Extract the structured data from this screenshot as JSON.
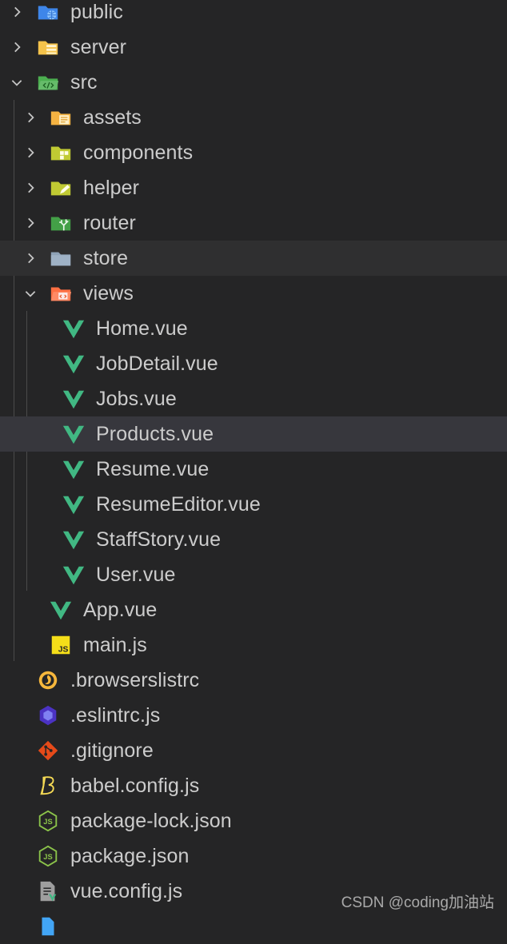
{
  "explorer": {
    "items": [
      {
        "label": "public"
      },
      {
        "label": "server"
      },
      {
        "label": "src"
      },
      {
        "label": "assets"
      },
      {
        "label": "components"
      },
      {
        "label": "helper"
      },
      {
        "label": "router"
      },
      {
        "label": "store"
      },
      {
        "label": "views"
      },
      {
        "label": "Home.vue"
      },
      {
        "label": "JobDetail.vue"
      },
      {
        "label": "Jobs.vue"
      },
      {
        "label": "Products.vue"
      },
      {
        "label": "Resume.vue"
      },
      {
        "label": "ResumeEditor.vue"
      },
      {
        "label": "StaffStory.vue"
      },
      {
        "label": "User.vue"
      },
      {
        "label": "App.vue"
      },
      {
        "label": "main.js"
      },
      {
        "label": ".browserslistrc"
      },
      {
        "label": ".eslintrc.js"
      },
      {
        "label": ".gitignore"
      },
      {
        "label": "babel.config.js"
      },
      {
        "label": "package-lock.json"
      },
      {
        "label": "package.json"
      },
      {
        "label": "vue.config.js"
      }
    ]
  },
  "watermark": "CSDN @coding加油站",
  "colors": {
    "background": "#252526",
    "selected_row": "#37373d",
    "hover_row": "#2f2f30",
    "vue_green": "#41b883",
    "text": "#cccccc"
  }
}
